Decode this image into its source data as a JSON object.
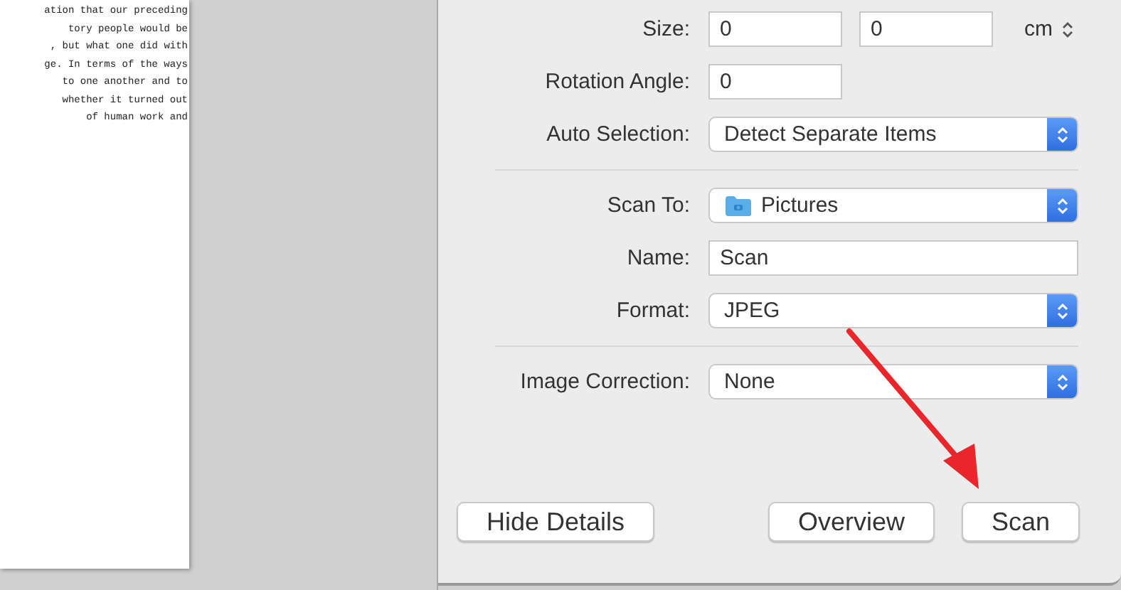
{
  "document": {
    "lines": [
      "ation that our preceding",
      "tory people would be",
      ", but what one did with",
      "ge. In terms of the ways",
      "to one another and to",
      "whether it turned out",
      "of human work and"
    ]
  },
  "settings": [
    {
      "kind": "size",
      "label": "Size:",
      "values": [
        "0",
        "0"
      ],
      "unit": "cm"
    },
    {
      "kind": "short-text",
      "label": "Rotation Angle:",
      "value": "0"
    },
    {
      "kind": "popup",
      "label": "Auto Selection:",
      "value": "Detect Separate Items"
    },
    {
      "kind": "separator"
    },
    {
      "kind": "folder-popup",
      "label": "Scan To:",
      "value": "Pictures"
    },
    {
      "kind": "text",
      "label": "Name:",
      "value": "Scan"
    },
    {
      "kind": "popup",
      "label": "Format:",
      "value": "JPEG"
    },
    {
      "kind": "separator"
    },
    {
      "kind": "popup",
      "label": "Image Correction:",
      "value": "None"
    }
  ],
  "buttons": [
    {
      "label": "Hide Details",
      "kind": "left"
    },
    {
      "label": "Overview",
      "kind": "right"
    },
    {
      "label": "Scan",
      "kind": "right"
    }
  ]
}
